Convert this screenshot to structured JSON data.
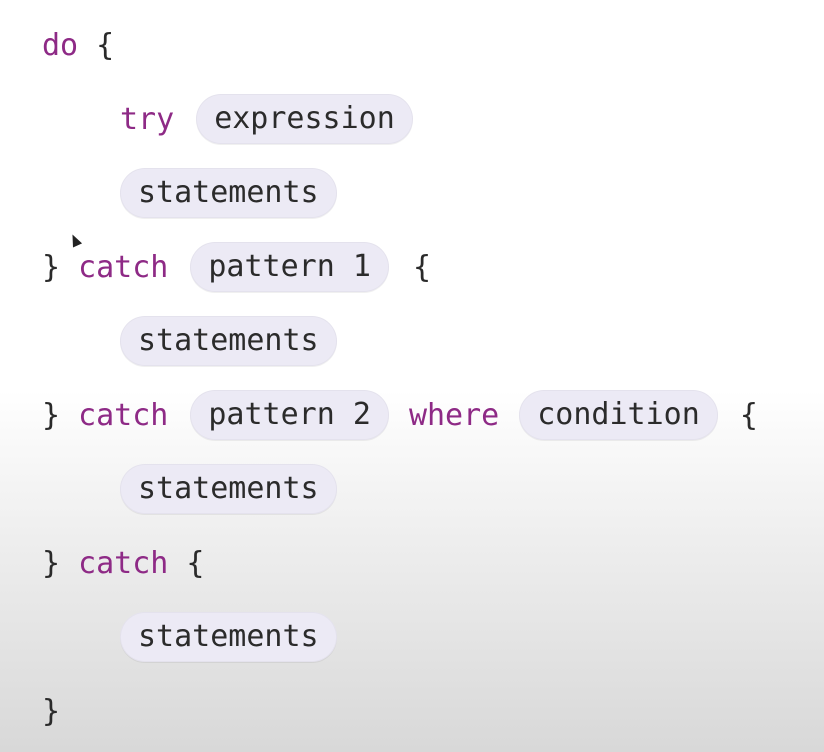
{
  "code": {
    "line1": {
      "keyword": "do",
      "brace": "{"
    },
    "line2": {
      "keyword": "try",
      "placeholder": "expression"
    },
    "line3": {
      "placeholder": "statements"
    },
    "line4": {
      "close": "}",
      "keyword": "catch",
      "placeholder": "pattern 1",
      "brace": "{"
    },
    "line5": {
      "placeholder": "statements"
    },
    "line6": {
      "close": "}",
      "keyword": "catch",
      "placeholder": "pattern 2",
      "keyword2": "where",
      "placeholder2": "condition",
      "brace": "{"
    },
    "line7": {
      "placeholder": "statements"
    },
    "line8": {
      "close": "}",
      "keyword": "catch",
      "brace": "{"
    },
    "line9": {
      "placeholder": "statements"
    },
    "line10": {
      "close": "}"
    }
  },
  "colors": {
    "keyword": "#8e2a86",
    "placeholder_bg": "#eceaf5",
    "text": "#2a2a2a"
  }
}
